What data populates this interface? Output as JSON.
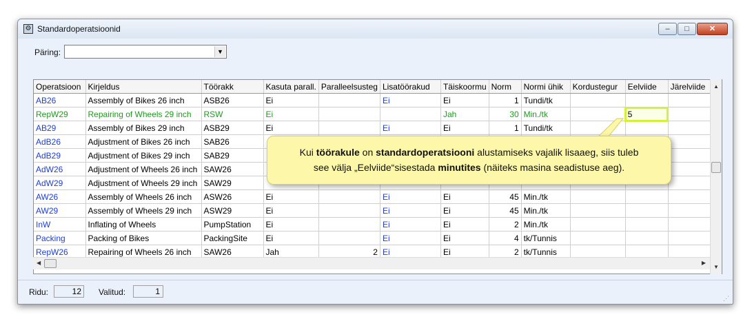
{
  "window": {
    "title": "Standardoperatsioonid",
    "buttons": {
      "minimize": "–",
      "maximize": "□",
      "close": "✕"
    }
  },
  "query": {
    "label": "Päring:",
    "value": ""
  },
  "grid": {
    "columns": [
      "Operatsioon",
      "Kirjeldus",
      "Töörakk",
      "Kasuta parall.",
      "Paralleelsusteg",
      "Lisatöörakud",
      "Täiskoormu",
      "Norm",
      "Normi ühik",
      "Kordustegur",
      "Eelviide",
      "Järelviide"
    ],
    "rows": [
      {
        "op": "AB26",
        "desc": "Assembly of Bikes 26 inch",
        "cell": "ASB26",
        "par": "Ei",
        "pdeg": "",
        "extra": "Ei",
        "full": "Ei",
        "norm": "1",
        "unit": "Tundi/tk",
        "rep": "",
        "pre": "",
        "post": "",
        "color": "blue"
      },
      {
        "op": "RepW29",
        "desc": "Repairing of Wheels 29 inch",
        "cell": "RSW",
        "par": "Ei",
        "pdeg": "",
        "extra": "",
        "full": "Jah",
        "norm": "30",
        "unit": "Min./tk",
        "rep": "",
        "pre": "5",
        "post": "",
        "color": "green"
      },
      {
        "op": "AB29",
        "desc": "Assembly of Bikes 29 inch",
        "cell": "ASB29",
        "par": "Ei",
        "pdeg": "",
        "extra": "Ei",
        "full": "Ei",
        "norm": "1",
        "unit": "Tundi/tk",
        "rep": "",
        "pre": "",
        "post": "",
        "color": "blue"
      },
      {
        "op": "AdB26",
        "desc": "Adjustment of Bikes 26 inch",
        "cell": "SAB26",
        "par": "",
        "pdeg": "",
        "extra": "",
        "full": "",
        "norm": "",
        "unit": "",
        "rep": "",
        "pre": "",
        "post": "",
        "color": "blue"
      },
      {
        "op": "AdB29",
        "desc": "Adjustment of Bikes 29 inch",
        "cell": "SAB29",
        "par": "",
        "pdeg": "",
        "extra": "",
        "full": "",
        "norm": "",
        "unit": "",
        "rep": "",
        "pre": "",
        "post": "",
        "color": "blue"
      },
      {
        "op": "AdW26",
        "desc": "Adjustment of Wheels 26 inch",
        "cell": "SAW26",
        "par": "",
        "pdeg": "",
        "extra": "",
        "full": "",
        "norm": "",
        "unit": "",
        "rep": "",
        "pre": "",
        "post": "",
        "color": "blue"
      },
      {
        "op": "AdW29",
        "desc": "Adjustment of Wheels 29 inch",
        "cell": "SAW29",
        "par": "",
        "pdeg": "",
        "extra": "",
        "full": "",
        "norm": "",
        "unit": "",
        "rep": "",
        "pre": "",
        "post": "",
        "color": "blue"
      },
      {
        "op": "AW26",
        "desc": "Assembly of Wheels 26 inch",
        "cell": "ASW26",
        "par": "Ei",
        "pdeg": "",
        "extra": "Ei",
        "full": "Ei",
        "norm": "45",
        "unit": "Min./tk",
        "rep": "",
        "pre": "",
        "post": "",
        "color": "blue"
      },
      {
        "op": "AW29",
        "desc": "Assembly of Wheels 29 inch",
        "cell": "ASW29",
        "par": "Ei",
        "pdeg": "",
        "extra": "Ei",
        "full": "Ei",
        "norm": "45",
        "unit": "Min./tk",
        "rep": "",
        "pre": "",
        "post": "",
        "color": "blue"
      },
      {
        "op": "InW",
        "desc": "Inflating of Wheels",
        "cell": "PumpStation",
        "par": "Ei",
        "pdeg": "",
        "extra": "Ei",
        "full": "Ei",
        "norm": "2",
        "unit": "Min./tk",
        "rep": "",
        "pre": "",
        "post": "",
        "color": "blue"
      },
      {
        "op": "Packing",
        "desc": "Packing of Bikes",
        "cell": "PackingSite",
        "par": "Ei",
        "pdeg": "",
        "extra": "Ei",
        "full": "Ei",
        "norm": "4",
        "unit": "tk/Tunnis",
        "rep": "",
        "pre": "",
        "post": "",
        "color": "blue"
      },
      {
        "op": "RepW26",
        "desc": "Repairing of Wheels 26 inch",
        "cell": "SAW26",
        "par": "Jah",
        "pdeg": "2",
        "extra": "Ei",
        "full": "Ei",
        "norm": "2",
        "unit": "tk/Tunnis",
        "rep": "",
        "pre": "",
        "post": "",
        "color": "blue"
      }
    ]
  },
  "status": {
    "rows_label": "Ridu:",
    "rows_value": "12",
    "selected_label": "Valitud:",
    "selected_value": "1"
  },
  "callout": {
    "p1": "Kui ",
    "b1": "töörakule",
    "p2": " on  ",
    "b2": "standardoperatsiooni",
    "p3": " alustamiseks vajalik lisaaeg, siis tuleb",
    "p4": "see välja „Eelviide“sisestada ",
    "b3": "minutites",
    "p5": " (näiteks masina seadistuse aeg)."
  },
  "colors": {
    "link_blue": "#1c3fd8",
    "active_green": "#1e9a1e",
    "callout_bg": "#fdf8a9",
    "highlight": "#d3f03a"
  }
}
